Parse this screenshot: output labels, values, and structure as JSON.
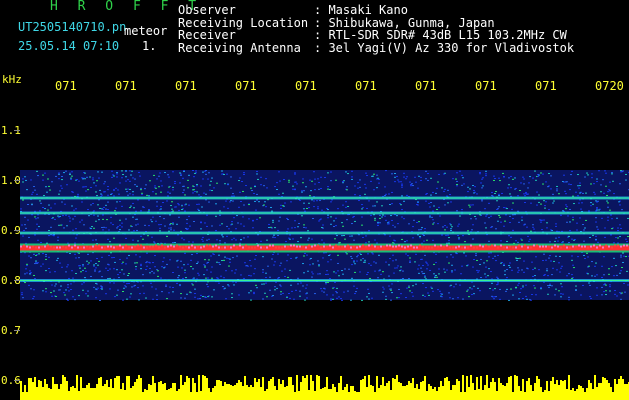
{
  "header": {
    "title": "H R O F F T",
    "filename": "UT2505140710.pn",
    "filetype": "meteor",
    "datetime": "25.05.14 07:10",
    "counter": "1.",
    "info_labels": "Observer\nReceiving Location\nReceiver\nReceiving Antenna",
    "info_values": ": Masaki Kano\n: Shibukawa, Gunma, Japan\n: RTL-SDR SDR# 43dB L15 103.2MHz CW\n: 3el Yagi(V) Az 330 for Vladivostok"
  },
  "axis": {
    "unit": "kHz",
    "y_ticks": [
      "1.1",
      "1.0",
      "0.9",
      "0.8",
      "0.7",
      "0.6"
    ],
    "time_ticks": [
      "071",
      "071",
      "071",
      "071",
      "071",
      "071",
      "071",
      "071",
      "071",
      "0720"
    ]
  },
  "spectrogram": {
    "band_top_khz": 1.02,
    "band_bottom_khz": 0.76,
    "carrier_khz": 0.865,
    "lines_khz": [
      0.965,
      0.935,
      0.895,
      0.8,
      0.865
    ],
    "noise_floor_khz": 0.6
  },
  "colors": {
    "title": "#2fd24a",
    "filename": "#3fd7e6",
    "info": "#ffffff",
    "labels": "#ffff33",
    "carrier": "#ff3030",
    "noise": "#ffff00"
  }
}
